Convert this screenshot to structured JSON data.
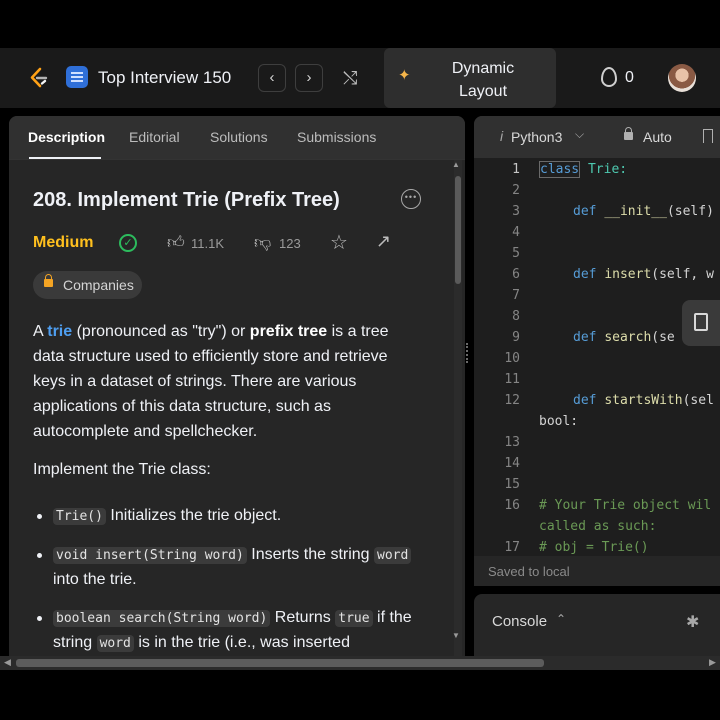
{
  "topbar": {
    "problem_list": "Top Interview 150",
    "prev_icon": "chevron-left-icon",
    "prev_glyph": "‹",
    "next_icon": "chevron-right-icon",
    "next_glyph": "›",
    "shuffle_glyph": "⤭",
    "dynamic_layout_label": "Dynamic Layout",
    "streak_count": "0"
  },
  "tabs": [
    "Description",
    "Editorial",
    "Solutions",
    "Submissions"
  ],
  "problem": {
    "title": "208. Implement Trie (Prefix Tree)",
    "difficulty": "Medium",
    "likes": "11.1K",
    "dislikes": "123",
    "companies": "Companies",
    "desc": {
      "p1": "A ",
      "trie": "trie",
      "p2": " (pronounced as \"try\") or ",
      "prefix_tree": "prefix tree",
      "p3": " is a tree data structure used to efficiently store and retrieve keys in a dataset of strings. There are various applications of this data structure, such as autocomplete and spellchecker."
    },
    "impl_text": "Implement the Trie class:",
    "items": [
      {
        "code": "Trie()",
        "text": " Initializes the trie object."
      },
      {
        "code": "void insert(String word)",
        "text": " Inserts the string ",
        "code2": "word",
        "text2": " into the trie."
      },
      {
        "code": "boolean search(String word)",
        "text": " Returns ",
        "code2": "true",
        "text2": " if the string ",
        "code3": "word",
        "text3": " is in the trie (i.e., was inserted"
      }
    ]
  },
  "editor": {
    "lang_prefix": "i",
    "lang": "Python3",
    "mode": "Auto",
    "saved": "Saved to local",
    "code_lines": [
      {
        "n": "1",
        "kw": "class",
        "rest": " Trie:"
      },
      {
        "n": "2"
      },
      {
        "n": "3",
        "kw": "def",
        "fn": "__init__",
        "rest": "(self)"
      },
      {
        "n": "4"
      },
      {
        "n": "5"
      },
      {
        "n": "6",
        "kw": "def",
        "fn": "insert",
        "rest": "(self, w"
      },
      {
        "n": "7"
      },
      {
        "n": "8"
      },
      {
        "n": "9",
        "kw": "def",
        "fn": "search",
        "rest": "(se"
      },
      {
        "n": "10"
      },
      {
        "n": "11"
      },
      {
        "n": "12",
        "kw": "def",
        "fn": "startsWith",
        "rest": "(sel"
      },
      {
        "cont": "bool:"
      },
      {
        "n": "13"
      },
      {
        "n": "14"
      },
      {
        "n": "15"
      },
      {
        "n": "16",
        "comment": "# Your Trie object wil"
      },
      {
        "comment_cont": "called as such:"
      },
      {
        "n": "17",
        "comment": "# obj = Trie()"
      }
    ]
  },
  "console": {
    "label": "Console"
  }
}
